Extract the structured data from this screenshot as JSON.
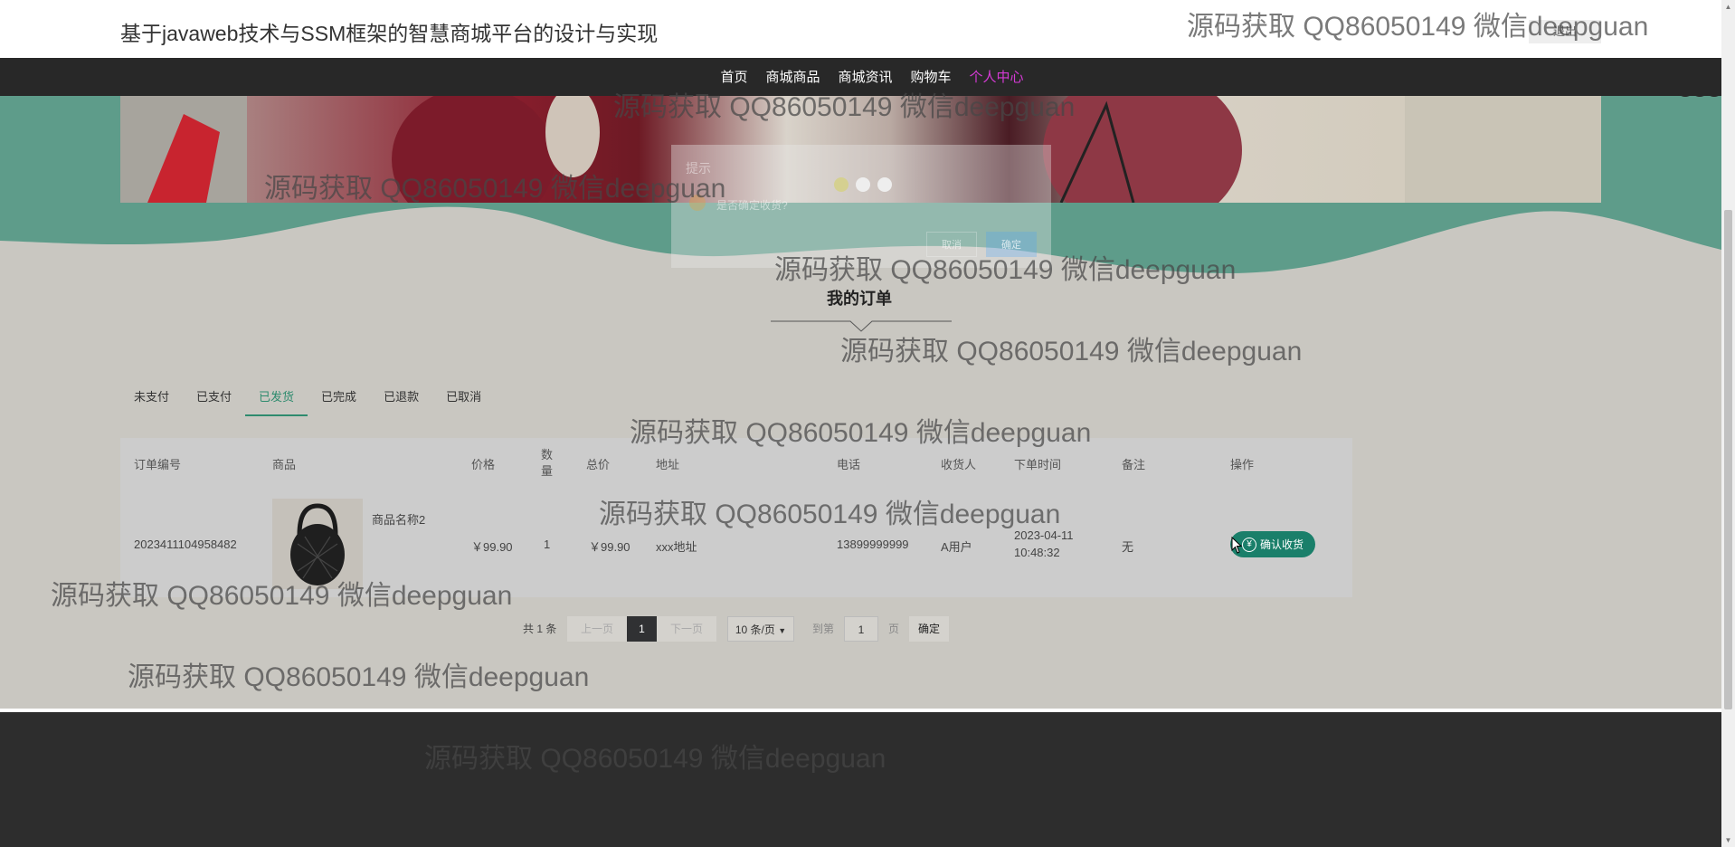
{
  "header": {
    "title": "基于javaweb技术与SSM框架的智慧商城平台的设计与实现",
    "logout": "退出"
  },
  "nav": {
    "items": [
      "首页",
      "商城商品",
      "商城资讯",
      "购物车",
      "个人中心"
    ],
    "active_index": 4,
    "active_color": "#d63ad6"
  },
  "carousel": {
    "slides": 3,
    "active_index": 0
  },
  "dialog": {
    "title": "提示",
    "message": "是否确定收货?",
    "cancel": "取消",
    "confirm": "确定"
  },
  "section": {
    "title": "我的订单"
  },
  "tabs": {
    "items": [
      "未支付",
      "已支付",
      "已发货",
      "已完成",
      "已退款",
      "已取消"
    ],
    "active_index": 2,
    "accent": "#2e8b6e"
  },
  "table": {
    "headers": [
      "订单编号",
      "商品",
      "价格",
      "数量",
      "总价",
      "地址",
      "电话",
      "收货人",
      "下单时间",
      "备注",
      "操作"
    ],
    "rows": [
      {
        "order_no": "2023411104958482",
        "product_name": "商品名称2",
        "price": "￥99.90",
        "qty": "1",
        "total": "￥99.90",
        "address": "xxx地址",
        "phone": "13899999999",
        "receiver": "A用户",
        "date": "2023-04-11",
        "time": "10:48:32",
        "note": "无",
        "action": "确认收货"
      }
    ]
  },
  "pagination": {
    "total_text": "共 1 条",
    "prev": "上一页",
    "page": "1",
    "next": "下一页",
    "size": "10 条/页",
    "goto": "到第",
    "goto_value": "1",
    "page_unit": "页",
    "confirm": "确定"
  },
  "watermark": "源码获取 QQ86050149 微信deepguan",
  "colors": {
    "nav_bg": "#282828",
    "teal": "#5e9c8a",
    "button": "#1a7f6a",
    "footer": "#2d2d2d"
  }
}
